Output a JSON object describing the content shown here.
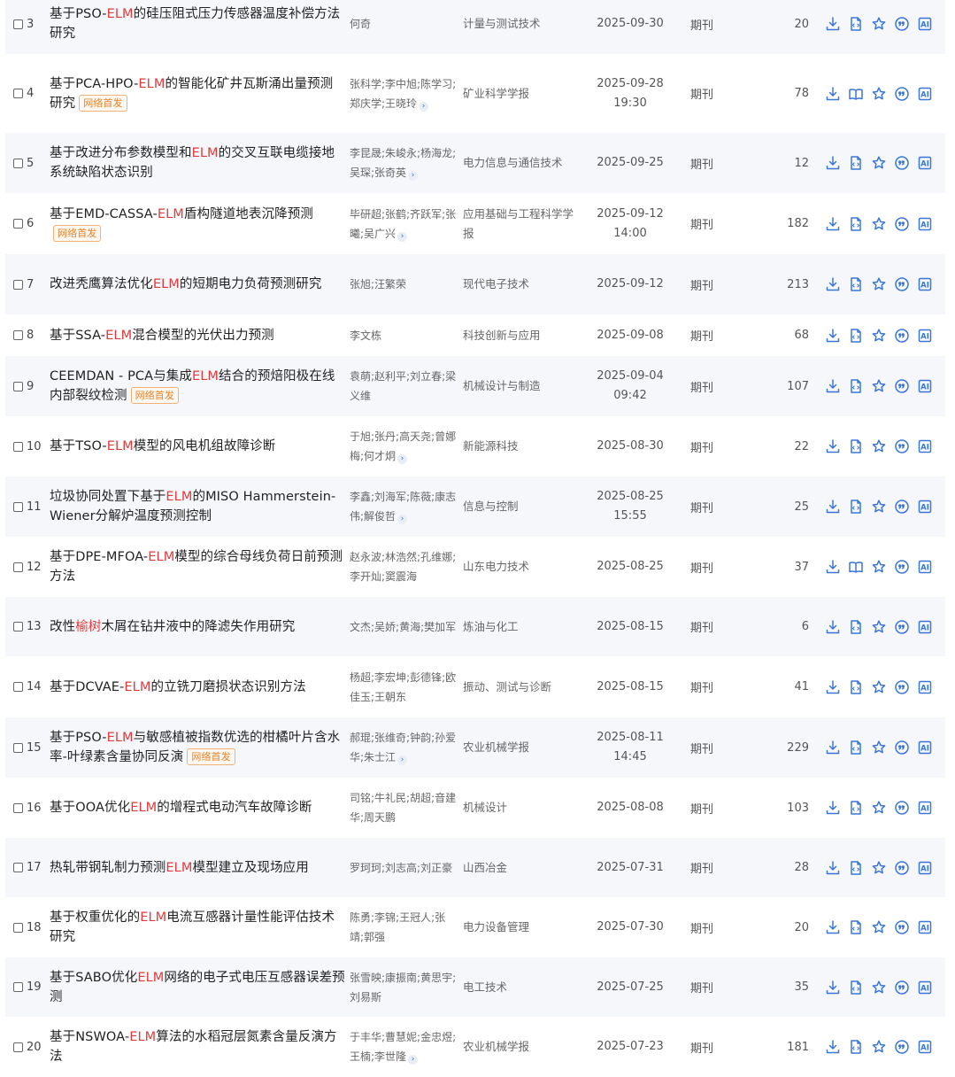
{
  "theme": {
    "highlight": "#e4393c",
    "icon_blue": "#3a76d6",
    "badge_orange": "#e8822a"
  },
  "results": [
    {
      "num": "3",
      "title": [
        "基于PSO-",
        {
          "hl": "ELM"
        },
        "的硅压阻式压力传感器温度补偿方法研究"
      ],
      "badge": "",
      "authors": "何奇",
      "authors_more": false,
      "source": "计量与测试技术",
      "date": "2025-09-30",
      "db": "期刊",
      "count": "20",
      "read_icon": "html-icon"
    },
    {
      "num": "4",
      "title": [
        "基于PCA-HPO-",
        {
          "hl": "ELM"
        },
        "的智能化矿井瓦斯涌出量预测研究"
      ],
      "badge": "网络首发",
      "authors": "张科学;李中旭;陈学习;郑庆学;王晓玲",
      "authors_more": true,
      "source": "矿业科学学报",
      "date": "2025-09-28 19:30",
      "db": "期刊",
      "count": "78",
      "read_icon": "book-icon"
    },
    {
      "num": "5",
      "title": [
        "基于改进分布参数模型和",
        {
          "hl": "ELM"
        },
        "的交叉互联电缆接地系统缺陷状态识别"
      ],
      "badge": "",
      "authors": "李昆晟;朱峻永;杨海龙;吴琛;张奇英",
      "authors_more": true,
      "source": "电力信息与通信技术",
      "date": "2025-09-25",
      "db": "期刊",
      "count": "12",
      "read_icon": "html-icon"
    },
    {
      "num": "6",
      "title": [
        "基于EMD-CASSA-",
        {
          "hl": "ELM"
        },
        "盾构隧道地表沉降预测"
      ],
      "badge": "网络首发",
      "authors": "毕研超;张鹤;齐跃军;张曦;吴广兴",
      "authors_more": true,
      "source": "应用基础与工程科学学报",
      "date": "2025-09-12 14:00",
      "db": "期刊",
      "count": "182",
      "read_icon": "html-icon"
    },
    {
      "num": "7",
      "title": [
        "改进秃鹰算法优化",
        {
          "hl": "ELM"
        },
        "的短期电力负荷预测研究"
      ],
      "badge": "",
      "authors": "张旭;汪繁荣",
      "authors_more": false,
      "source": "现代电子技术",
      "date": "2025-09-12",
      "db": "期刊",
      "count": "213",
      "read_icon": "html-icon"
    },
    {
      "num": "8",
      "title": [
        "基于SSA-",
        {
          "hl": "ELM"
        },
        "混合模型的光伏出力预测"
      ],
      "badge": "",
      "authors": "李文栋",
      "authors_more": false,
      "source": "科技创新与应用",
      "date": "2025-09-08",
      "db": "期刊",
      "count": "68",
      "read_icon": "html-icon"
    },
    {
      "num": "9",
      "title": [
        "CEEMDAN - PCA与集成",
        {
          "hl": "ELM"
        },
        "结合的预焙阳极在线内部裂纹检测"
      ],
      "badge": "网络首发",
      "authors": "袁萌;赵利平;刘立春;梁义维",
      "authors_more": false,
      "source": "机械设计与制造",
      "date": "2025-09-04 09:42",
      "db": "期刊",
      "count": "107",
      "read_icon": "html-icon"
    },
    {
      "num": "10",
      "title": [
        "基于TSO-",
        {
          "hl": "ELM"
        },
        "模型的风电机组故障诊断"
      ],
      "badge": "",
      "authors": "于旭;张丹;高天尧;曾娜梅;何才炯",
      "authors_more": true,
      "source": "新能源科技",
      "date": "2025-08-30",
      "db": "期刊",
      "count": "22",
      "read_icon": "html-icon"
    },
    {
      "num": "11",
      "title": [
        "垃圾协同处置下基于",
        {
          "hl": "ELM"
        },
        "的MISO Hammerstein-Wiener分解炉温度预测控制"
      ],
      "badge": "",
      "authors": "李鑫;刘海军;陈薇;康志伟;解俊哲",
      "authors_more": true,
      "source": "信息与控制",
      "date": "2025-08-25 15:55",
      "db": "期刊",
      "count": "25",
      "read_icon": "html-icon"
    },
    {
      "num": "12",
      "title": [
        "基于DPE-MFOA-",
        {
          "hl": "ELM"
        },
        "模型的综合母线负荷日前预测方法"
      ],
      "badge": "",
      "authors": "赵永波;林浩然;孔维娜;李开灿;窦震海",
      "authors_more": false,
      "source": "山东电力技术",
      "date": "2025-08-25",
      "db": "期刊",
      "count": "37",
      "read_icon": "book-icon"
    },
    {
      "num": "13",
      "title": [
        "改性",
        {
          "hl": "榆树"
        },
        "木屑在钻井液中的降滤失作用研究"
      ],
      "badge": "",
      "authors": "文杰;吴娇;黄海;樊加军",
      "authors_more": false,
      "source": "炼油与化工",
      "date": "2025-08-15",
      "db": "期刊",
      "count": "6",
      "read_icon": "html-icon"
    },
    {
      "num": "14",
      "title": [
        "基于DCVAE-",
        {
          "hl": "ELM"
        },
        "的立铣刀磨损状态识别方法"
      ],
      "badge": "",
      "authors": "杨超;李宏坤;彭德锋;欧佳玉;王朝东",
      "authors_more": false,
      "source": "振动、测试与诊断",
      "date": "2025-08-15",
      "db": "期刊",
      "count": "41",
      "read_icon": "html-icon"
    },
    {
      "num": "15",
      "title": [
        "基于PSO-",
        {
          "hl": "ELM"
        },
        "与敏感植被指数优选的柑橘叶片含水率-叶绿素含量协同反演"
      ],
      "badge": "网络首发",
      "authors": "郝琨;张维奇;钟韵;孙爱华;朱士江",
      "authors_more": true,
      "source": "农业机械学报",
      "date": "2025-08-11 14:45",
      "db": "期刊",
      "count": "229",
      "read_icon": "html-icon"
    },
    {
      "num": "16",
      "title": [
        "基于OOA优化",
        {
          "hl": "ELM"
        },
        "的增程式电动汽车故障诊断"
      ],
      "badge": "",
      "authors": "司铭;牛礼民;胡超;音建华;周天鹏",
      "authors_more": false,
      "source": "机械设计",
      "date": "2025-08-08",
      "db": "期刊",
      "count": "103",
      "read_icon": "html-icon"
    },
    {
      "num": "17",
      "title": [
        "热轧带钢轧制力预测",
        {
          "hl": "ELM"
        },
        "模型建立及现场应用"
      ],
      "badge": "",
      "authors": "罗珂珂;刘志高;刘正豪",
      "authors_more": false,
      "source": "山西冶金",
      "date": "2025-07-31",
      "db": "期刊",
      "count": "28",
      "read_icon": "html-icon"
    },
    {
      "num": "18",
      "title": [
        "基于权重优化的",
        {
          "hl": "ELM"
        },
        "电流互感器计量性能评估技术研究"
      ],
      "badge": "",
      "authors": "陈勇;李锦;王冠人;张靖;郭强",
      "authors_more": false,
      "source": "电力设备管理",
      "date": "2025-07-30",
      "db": "期刊",
      "count": "20",
      "read_icon": "html-icon"
    },
    {
      "num": "19",
      "title": [
        "基于SABO优化",
        {
          "hl": "ELM"
        },
        "网络的电子式电压互感器误差预测"
      ],
      "badge": "",
      "authors": "张雪映;康振南;黄思宇;刘易斯",
      "authors_more": false,
      "source": "电工技术",
      "date": "2025-07-25",
      "db": "期刊",
      "count": "35",
      "read_icon": "html-icon"
    },
    {
      "num": "20",
      "title": [
        "基于NSWOA-",
        {
          "hl": "ELM"
        },
        "算法的水稻冠层氮素含量反演方法"
      ],
      "badge": "",
      "authors": "于丰华;曹慧妮;金忠煜;王楠;李世隆",
      "authors_more": true,
      "source": "农业机械学报",
      "date": "2025-07-23",
      "db": "期刊",
      "count": "181",
      "read_icon": "html-icon"
    }
  ],
  "row_icons": [
    "download-icon",
    "read-icon",
    "favorite-star-icon",
    "cite-quote-icon",
    "ai-assistant-icon"
  ],
  "ai_label": "AI",
  "more_glyph": "›"
}
